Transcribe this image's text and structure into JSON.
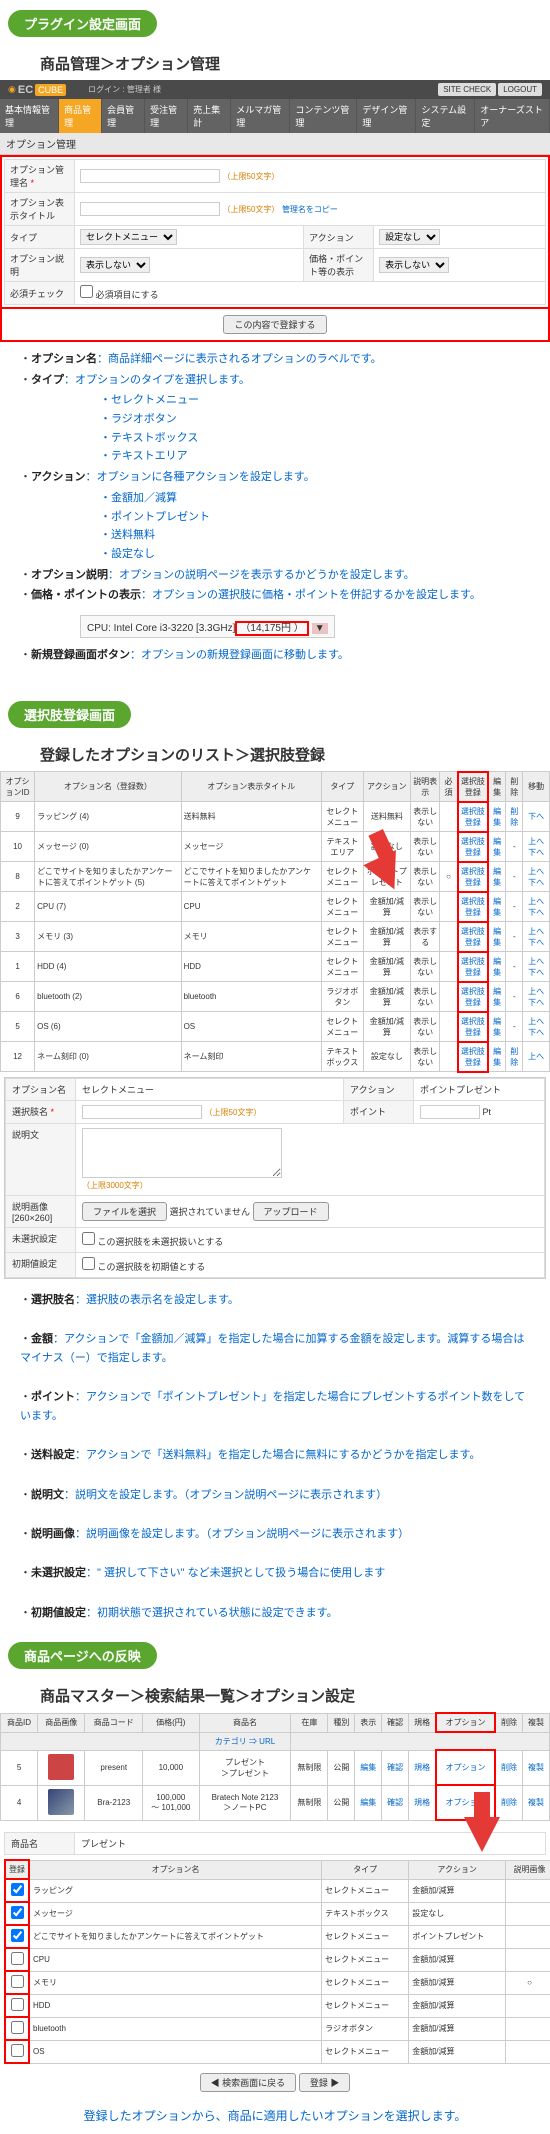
{
  "pills": {
    "p1": "プラグイン設定画面",
    "p2": "選択肢登録画面",
    "p3": "商品ページへの反映"
  },
  "subs": {
    "s1": "商品管理＞オプション管理",
    "s2": "登録したオプションのリスト＞選択肢登録",
    "s3": "商品マスター＞検索結果一覧＞オプション設定"
  },
  "header": {
    "login": "ログイン : 管理者 様",
    "siteCheck": "SITE CHECK",
    "logout": "LOGOUT",
    "brand1": "EC",
    "brand2": "CUBE"
  },
  "menu": [
    "基本情報管理",
    "商品管理",
    "会員管理",
    "受注管理",
    "売上集計",
    "メルマガ管理",
    "コンテンツ管理",
    "デザイン管理",
    "システム設定",
    "オーナーズストア"
  ],
  "panelTitle": "オプション管理",
  "form": {
    "optName": "オプション管理名",
    "limit50": "（上限50文字）",
    "dispTitle": "オプション表示タイトル",
    "copy": "管理名をコピー",
    "type": "タイプ",
    "typeVal": "セレクトメニュー",
    "action": "アクション",
    "actionVal": "設定なし",
    "desc": "オプション説明",
    "descVal": "表示しない",
    "pricePt": "価格・ポイント等の表示",
    "pricePtVal": "表示しない",
    "required": "必須チェック",
    "requiredLabel": "必須項目にする",
    "submit": "この内容で登録する"
  },
  "notes": {
    "n1a": "オプション名",
    "n1b": "：商品詳細ページに表示されるオプションのラベルです。",
    "n2a": "タイプ",
    "n2b": "：オプションのタイプを選択します。",
    "types": [
      "セレクトメニュー",
      "ラジオボタン",
      "テキストボックス",
      "テキストエリア"
    ],
    "n3a": "アクション",
    "n3b": "：オプションに各種アクションを設定します。",
    "actions": [
      "金額加／減算",
      "ポイントプレゼント",
      "送料無料",
      "設定なし"
    ],
    "n4a": "オプション説明",
    "n4b": "：オプションの説明ページを表示するかどうかを設定します。",
    "n5a": "価格・ポイントの表示",
    "n5b": "：オプションの選択肢に価格・ポイントを併記するかを設定します。",
    "cpu": "CPU: Intel Core i3-3220 [3.3GHz]",
    "cpuPrice": "（14,175円 ）",
    "n6a": "新規登録画面ボタン",
    "n6b": "：オプションの新規登録画面に移動します。"
  },
  "gridHead": [
    "オプションID",
    "オプション名（登録数）",
    "オプション表示タイトル",
    "タイプ",
    "アクション",
    "説明表示",
    "必須",
    "選択肢登録",
    "編集",
    "削除",
    "移動"
  ],
  "gridRows": [
    {
      "id": "9",
      "name": "ラッピング (4)",
      "title": "送料無料",
      "type": "セレクトメニュー",
      "act": "送料無料",
      "desc": "表示しない",
      "req": "",
      "edit": "編集",
      "del": "削除",
      "mv": "下へ"
    },
    {
      "id": "10",
      "name": "メッセージ (0)",
      "title": "メッセージ",
      "type": "テキストエリア",
      "act": "設定なし",
      "desc": "表示しない",
      "req": "",
      "edit": "編集",
      "del": "-",
      "mv": "上へ 下へ"
    },
    {
      "id": "8",
      "name": "どこでサイトを知りましたかアンケートに答えてポイントゲット (5)",
      "title": "どこでサイトを知りましたかアンケートに答えてポイントゲット",
      "type": "セレクトメニュー",
      "act": "ポイントプレゼント",
      "desc": "表示しない",
      "req": "○",
      "edit": "編集",
      "del": "-",
      "mv": "上へ 下へ"
    },
    {
      "id": "2",
      "name": "CPU (7)",
      "title": "CPU",
      "type": "セレクトメニュー",
      "act": "金額加/減算",
      "desc": "表示しない",
      "req": "",
      "edit": "編集",
      "del": "-",
      "mv": "上へ 下へ"
    },
    {
      "id": "3",
      "name": "メモリ (3)",
      "title": "メモリ",
      "type": "セレクトメニュー",
      "act": "金額加/減算",
      "desc": "表示する",
      "req": "",
      "edit": "編集",
      "del": "-",
      "mv": "上へ 下へ"
    },
    {
      "id": "1",
      "name": "HDD (4)",
      "title": "HDD",
      "type": "セレクトメニュー",
      "act": "金額加/減算",
      "desc": "表示しない",
      "req": "",
      "edit": "編集",
      "del": "-",
      "mv": "上へ 下へ"
    },
    {
      "id": "6",
      "name": "bluetooth (2)",
      "title": "bluetooth",
      "type": "ラジオボタン",
      "act": "金額加/減算",
      "desc": "表示しない",
      "req": "",
      "edit": "編集",
      "del": "-",
      "mv": "上へ 下へ"
    },
    {
      "id": "5",
      "name": "OS (6)",
      "title": "OS",
      "type": "セレクトメニュー",
      "act": "金額加/減算",
      "desc": "表示しない",
      "req": "",
      "edit": "編集",
      "del": "-",
      "mv": "上へ 下へ"
    },
    {
      "id": "12",
      "name": "ネーム刻印 (0)",
      "title": "ネーム刻印",
      "type": "テキストボックス",
      "act": "設定なし",
      "desc": "表示しない",
      "req": "",
      "edit": "編集",
      "del": "削除",
      "mv": "上へ"
    }
  ],
  "choiceLabel": "選択肢登録",
  "form2": {
    "optName": "オプション名",
    "optNameVal": "セレクトメニュー",
    "actionL": "アクション",
    "actionVal": "ポイントプレゼント",
    "choice": "選択肢名",
    "limit": "（上限50文字）",
    "pt": "ポイント",
    "ptUnit": "Pt",
    "desc": "説明文",
    "limit3000": "（上限3000文字）",
    "img": "説明画像 [260×260]",
    "fileBtn": "ファイルを選択",
    "noFile": "選択されていません",
    "upload": "アップロード",
    "unsel": "未選択設定",
    "unselChk": "この選択肢を未選択扱いとする",
    "init": "初期値設定",
    "initChk": "この選択肢を初期値とする"
  },
  "notes2": {
    "a1": "選択肢名",
    "a1b": "：選択肢の表示名を設定します。",
    "a2": "金額",
    "a2b": "：アクションで「金額加／減算」を指定した場合に加算する金額を設定します。減算する場合はマイナス（ー）で指定します。",
    "a3": "ポイント",
    "a3b": "：アクションで「ポイントプレゼント」を指定した場合にプレゼントするポイント数をしています。",
    "a4": "送料設定",
    "a4b": "：アクションで「送料無料」を指定した場合に無料にするかどうかを指定します。",
    "a5": "説明文",
    "a5b": "：説明文を設定します。（オプション説明ページに表示されます）",
    "a6": "説明画像",
    "a6b": "：説明画像を設定します。（オプション説明ページに表示されます）",
    "a7": "未選択設定",
    "a7b": "：\" 選択して下さい\" など未選択として扱う場合に使用します",
    "a8": "初期値設定",
    "a8b": "：初期状態で選択されている状態に設定できます。"
  },
  "prodHead": [
    "商品ID",
    "商品画像",
    "商品コード",
    "価格(円)",
    "商品名",
    "在庫",
    "種別",
    "表示",
    "確認",
    "規格",
    "オプション",
    "削除",
    "複製"
  ],
  "prodCat": "カテゴリ ⇒ URL",
  "prodRows": [
    {
      "id": "5",
      "code": "present",
      "price": "10,000",
      "names": [
        "プレゼント",
        "＞プレゼント"
      ],
      "stock": "無制限",
      "kind": "公開",
      "edit": "編集",
      "confirm": "確認",
      "spec": "規格",
      "opt": "オプション",
      "del": "削除",
      "dup": "複製"
    },
    {
      "id": "4",
      "code": "Bra-2123",
      "price": "100,000\n～ 101,000",
      "names": [
        "Bratech Note 2123",
        "＞ノートPC"
      ],
      "stock": "無制限",
      "kind": "公開",
      "edit": "編集",
      "confirm": "確認",
      "spec": "規格",
      "opt": "オプション",
      "del": "削除",
      "dup": "複製"
    }
  ],
  "assign": {
    "prodLabel": "商品名",
    "prodVal": "プレゼント",
    "head": [
      "登録",
      "オプション名",
      "タイプ",
      "アクション",
      "説明画像"
    ],
    "rows": [
      {
        "chk": true,
        "name": "ラッピング",
        "type": "セレクトメニュー",
        "act": "金額加/減算",
        "img": ""
      },
      {
        "chk": true,
        "name": "メッセージ",
        "type": "テキストボックス",
        "act": "設定なし",
        "img": ""
      },
      {
        "chk": true,
        "name": "どこでサイトを知りましたかアンケートに答えてポイントゲット",
        "type": "セレクトメニュー",
        "act": "ポイントプレゼント",
        "img": ""
      },
      {
        "chk": false,
        "name": "CPU",
        "type": "セレクトメニュー",
        "act": "金額加/減算",
        "img": ""
      },
      {
        "chk": false,
        "name": "メモリ",
        "type": "セレクトメニュー",
        "act": "金額加/減算",
        "img": "○"
      },
      {
        "chk": false,
        "name": "HDD",
        "type": "セレクトメニュー",
        "act": "金額加/減算",
        "img": ""
      },
      {
        "chk": false,
        "name": "bluetooth",
        "type": "ラジオボタン",
        "act": "金額加/減算",
        "img": ""
      },
      {
        "chk": false,
        "name": "OS",
        "type": "セレクトメニュー",
        "act": "金額加/減算",
        "img": ""
      }
    ],
    "back": "◀ 検索画面に戻る",
    "reg": "登録 ▶"
  },
  "footer": "登録したオプションから、商品に適用したいオプションを選択します。"
}
